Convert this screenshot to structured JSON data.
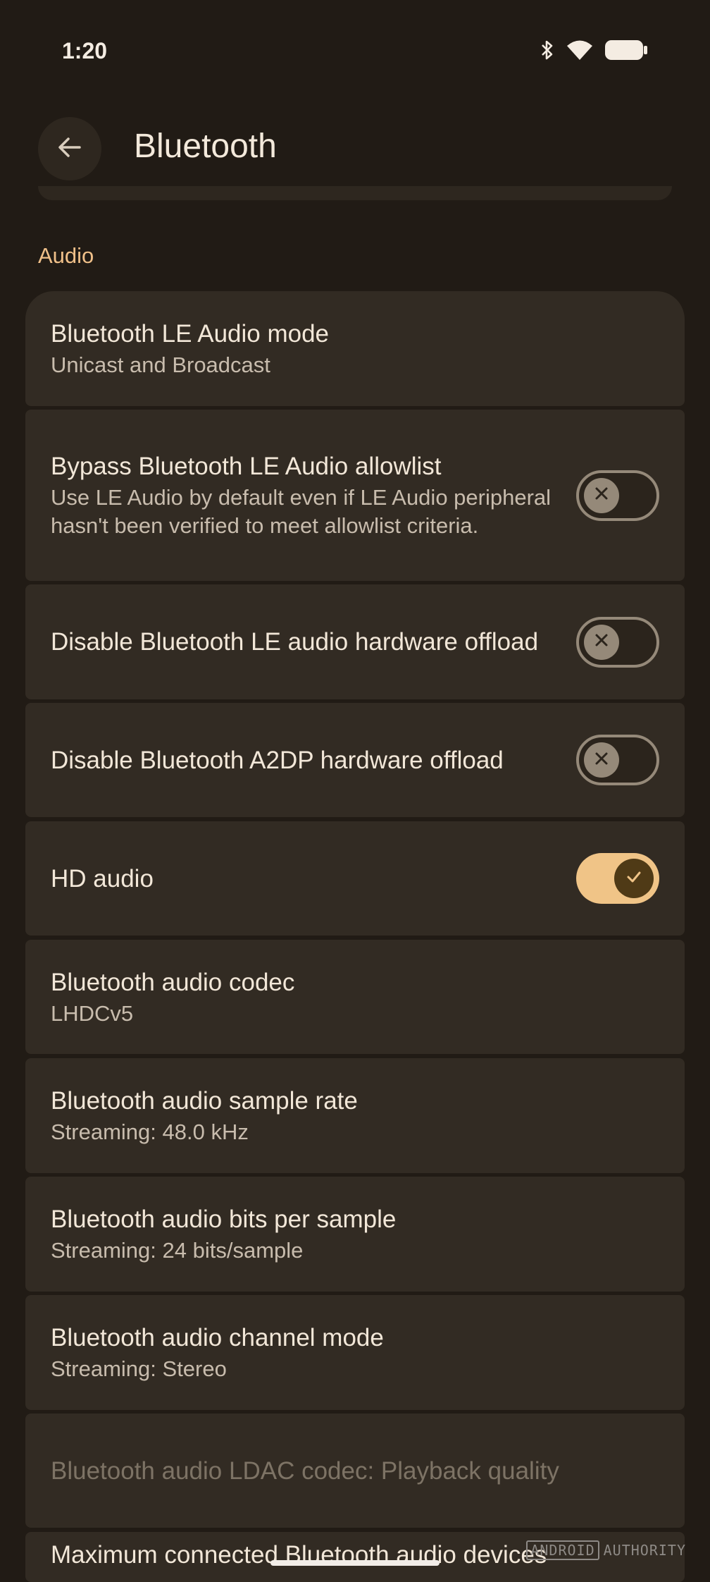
{
  "status_bar": {
    "time": "1:20",
    "icons": [
      "bluetooth-icon",
      "wifi-icon",
      "battery-icon"
    ]
  },
  "top_bar": {
    "title": "Bluetooth",
    "back_icon": "arrow-back-icon"
  },
  "section": {
    "header": "Audio"
  },
  "items": [
    {
      "title": "Bluetooth LE Audio mode",
      "summary": "Unicast and Broadcast"
    },
    {
      "title": "Bypass Bluetooth LE Audio allowlist",
      "summary": "Use LE Audio by default even if LE Audio peripheral hasn't been verified to meet allowlist criteria.",
      "switch": "off"
    },
    {
      "title": "Disable Bluetooth LE audio hardware offload",
      "switch": "off"
    },
    {
      "title": "Disable Bluetooth A2DP hardware offload",
      "switch": "off"
    },
    {
      "title": "HD audio",
      "switch": "on"
    },
    {
      "title": "Bluetooth audio codec",
      "summary": "LHDCv5"
    },
    {
      "title": "Bluetooth audio sample rate",
      "summary": "Streaming: 48.0 kHz"
    },
    {
      "title": "Bluetooth audio bits per sample",
      "summary": "Streaming: 24 bits/sample"
    },
    {
      "title": "Bluetooth audio channel mode",
      "summary": "Streaming: Stereo"
    },
    {
      "title": "Bluetooth audio LDAC codec: Playback quality",
      "disabled": true
    },
    {
      "title": "Maximum connected Bluetooth audio devices"
    }
  ],
  "watermark": {
    "brand": "ANDROID",
    "suffix": "AUTHORITY"
  },
  "colors": {
    "background": "#211b15",
    "card": "#322b23",
    "accent": "#f0c487",
    "section_header": "#f0c089"
  }
}
